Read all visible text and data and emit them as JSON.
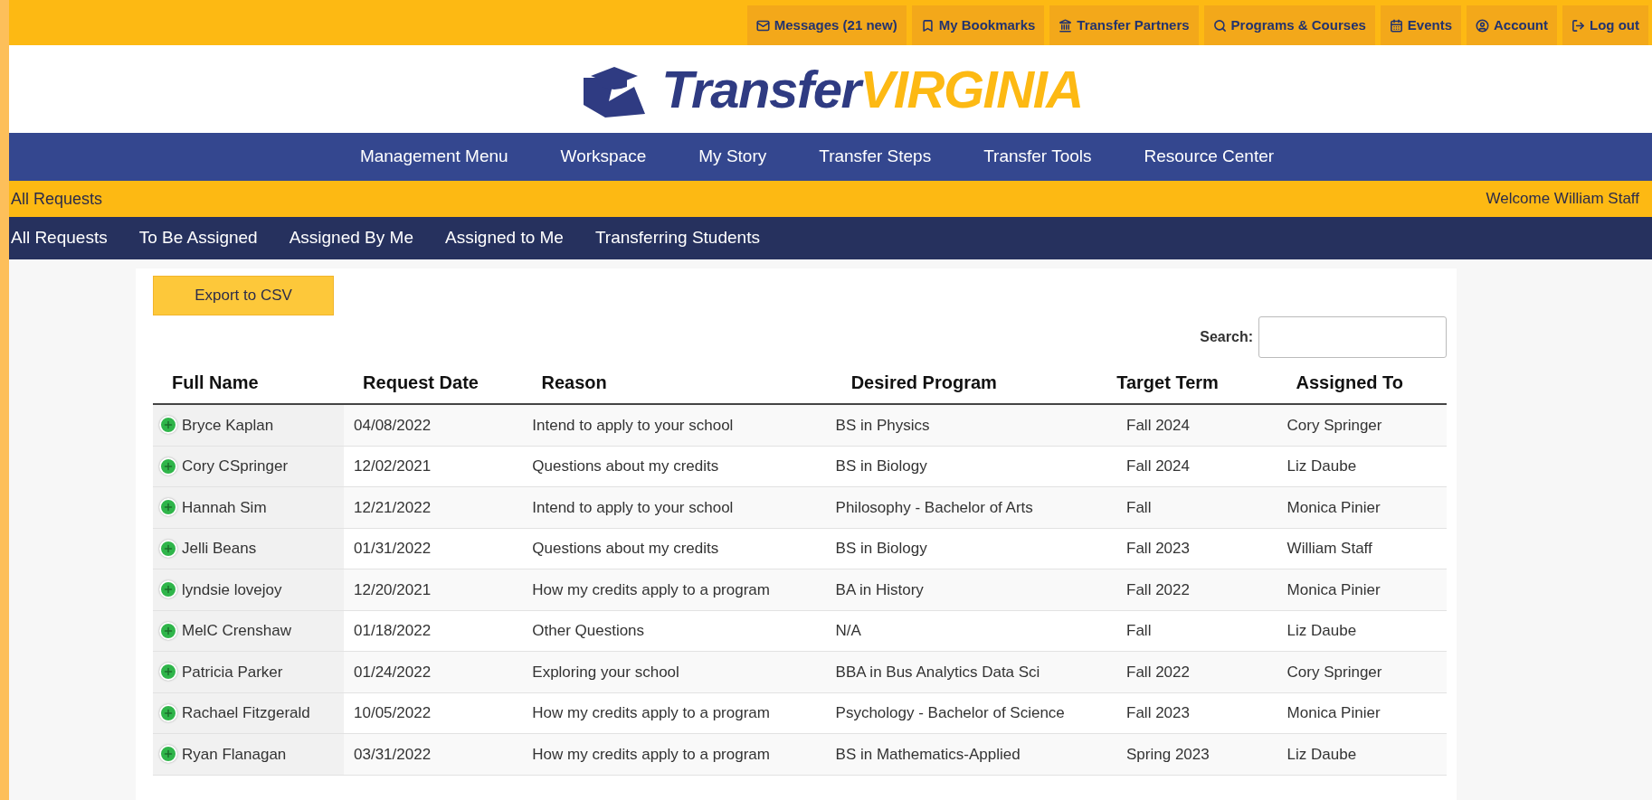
{
  "top_links": [
    "Messages (21 new)",
    "My Bookmarks",
    "Transfer Partners",
    "Programs & Courses",
    "Events",
    "Account",
    "Log out"
  ],
  "logo": {
    "part_1": "Transfer",
    "part_2": "VIRGINIA"
  },
  "main_nav": [
    "Management Menu",
    "Workspace",
    "My Story",
    "Transfer Steps",
    "Transfer Tools",
    "Resource Center"
  ],
  "page_bar": {
    "title": "All Requests",
    "welcome": "Welcome William Staff"
  },
  "sub_nav": [
    "All Requests",
    "To Be Assigned",
    "Assigned By Me",
    "Assigned to Me",
    "Transferring Students"
  ],
  "export_button": "Export to CSV",
  "search": {
    "label": "Search:"
  },
  "table": {
    "columns": [
      "Full Name",
      "Request Date",
      "Reason",
      "Desired Program",
      "Target Term",
      "Assigned To"
    ],
    "rows": [
      [
        "Bryce Kaplan",
        "04/08/2022",
        "Intend to apply to your school",
        "BS in Physics",
        "Fall 2024",
        "Cory Springer"
      ],
      [
        "Cory CSpringer",
        "12/02/2021",
        "Questions about my credits",
        "BS in Biology",
        "Fall 2024",
        "Liz Daube"
      ],
      [
        "Hannah Sim",
        "12/21/2022",
        "Intend to apply to your school",
        "Philosophy - Bachelor of Arts",
        "Fall",
        "Monica Pinier"
      ],
      [
        "Jelli Beans",
        "01/31/2022",
        "Questions about my credits",
        "BS in Biology",
        "Fall 2023",
        "William Staff"
      ],
      [
        "lyndsie lovejoy",
        "12/20/2021",
        "How my credits apply to a program",
        "BA in History",
        "Fall 2022",
        "Monica Pinier"
      ],
      [
        "MelC Crenshaw",
        "01/18/2022",
        "Other Questions",
        "N/A",
        "Fall",
        "Liz Daube"
      ],
      [
        "Patricia Parker",
        "01/24/2022",
        "Exploring your school",
        "BBA in Bus Analytics Data Sci",
        "Fall 2022",
        "Cory Springer"
      ],
      [
        "Rachael Fitzgerald",
        "10/05/2022",
        "How my credits apply to a program",
        "Psychology - Bachelor of Science",
        "Fall 2023",
        "Monica Pinier"
      ],
      [
        "Ryan Flanagan",
        "03/31/2022",
        "How my credits apply to a program",
        "BS in Mathematics-Applied",
        "Spring 2023",
        "Liz Daube"
      ]
    ]
  }
}
